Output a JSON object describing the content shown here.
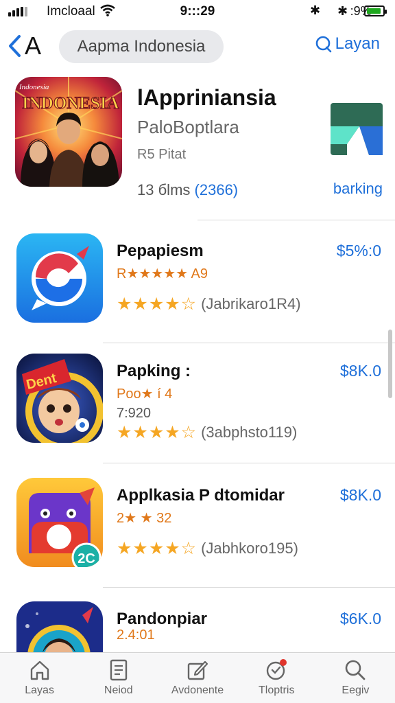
{
  "status_bar": {
    "carrier": "Imcloaal",
    "time": "9:::29",
    "battery_text": "✱ :9%",
    "bluetooth_symbol": "✱",
    "battery_level": 0.9
  },
  "nav": {
    "back_label": "A",
    "search_text": "Aapma Indonesia",
    "action_label": "Layan",
    "accent_color": "#1e6fd9"
  },
  "featured": {
    "art_text": "INDONESIA",
    "art_subtext": "Indonesia",
    "title": "lAppriniansia",
    "developer": "PaloBoptlara",
    "subtitle": "R5 Pitat",
    "rating_text": "13 бlms",
    "rating_count": "(2366)",
    "side_label": "barking"
  },
  "apps": [
    {
      "name": "Pepapiesm",
      "meta": "R★★★★★ A9",
      "meta2": "",
      "stars": "★★★★☆",
      "reviews": "(Jabrikaro1R4)",
      "price": "$5%:0",
      "icon": "chat-bubble-icon"
    },
    {
      "name": "Papking :",
      "meta": "Poo★ í 4",
      "meta2": "7:920",
      "stars": "★★★★☆",
      "reviews": "(3abphsto119)",
      "price": "$8K.0",
      "icon": "cartoon-face-icon"
    },
    {
      "name": "Applkasia P dtomidar",
      "meta": "2★ ★ 32",
      "meta2": "",
      "stars": "★★★★☆",
      "reviews": "(Jabhkoro195)",
      "price": "$8K.0",
      "icon": "purple-monster-icon",
      "badge": "2C"
    },
    {
      "name": "Pandonpiar",
      "meta": "2.4:01",
      "meta2": "",
      "stars": "",
      "reviews": "",
      "price": "$6K.0",
      "icon": "portrait-icon"
    }
  ],
  "tabs": [
    {
      "label": "Layas",
      "icon": "home-icon"
    },
    {
      "label": "Neiod",
      "icon": "document-icon"
    },
    {
      "label": "Avdonente",
      "icon": "edit-icon"
    },
    {
      "label": "Tloptris",
      "icon": "heart-badge-icon"
    },
    {
      "label": "Eegiv",
      "icon": "search-icon"
    }
  ]
}
